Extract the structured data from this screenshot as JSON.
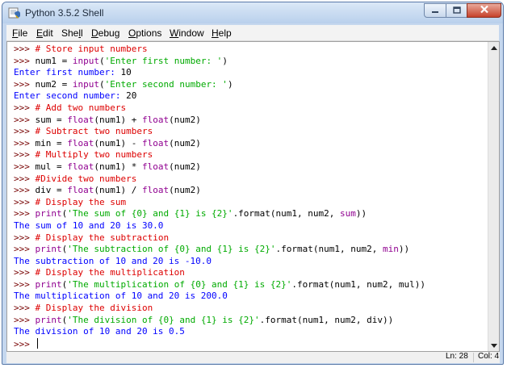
{
  "window": {
    "title": "Python 3.5.2 Shell"
  },
  "menu": [
    {
      "pre": "",
      "u": "F",
      "post": "ile"
    },
    {
      "pre": "",
      "u": "E",
      "post": "dit"
    },
    {
      "pre": "She",
      "u": "l",
      "post": "l"
    },
    {
      "pre": "",
      "u": "D",
      "post": "ebug"
    },
    {
      "pre": "",
      "u": "O",
      "post": "ptions"
    },
    {
      "pre": "",
      "u": "W",
      "post": "indow"
    },
    {
      "pre": "",
      "u": "H",
      "post": "elp"
    }
  ],
  "colors": {
    "prompt": "#770000",
    "comment": "#dd0000",
    "builtin": "#900090",
    "string": "#00aa00",
    "stdout": "#0000ff"
  },
  "shell_lines": [
    [
      {
        "t": "prompt",
        "v": ">>> "
      },
      {
        "t": "comment",
        "v": "# Store input numbers"
      }
    ],
    [
      {
        "t": "prompt",
        "v": ">>> "
      },
      {
        "t": "code",
        "v": "num1 = "
      },
      {
        "t": "builtin",
        "v": "input"
      },
      {
        "t": "code",
        "v": "("
      },
      {
        "t": "string",
        "v": "'Enter first number: '"
      },
      {
        "t": "code",
        "v": ")"
      }
    ],
    [
      {
        "t": "stdout",
        "v": "Enter first number: "
      },
      {
        "t": "code",
        "v": "10"
      }
    ],
    [
      {
        "t": "prompt",
        "v": ">>> "
      },
      {
        "t": "code",
        "v": "num2 = "
      },
      {
        "t": "builtin",
        "v": "input"
      },
      {
        "t": "code",
        "v": "("
      },
      {
        "t": "string",
        "v": "'Enter second number: '"
      },
      {
        "t": "code",
        "v": ")"
      }
    ],
    [
      {
        "t": "stdout",
        "v": "Enter second number: "
      },
      {
        "t": "code",
        "v": "20"
      }
    ],
    [
      {
        "t": "prompt",
        "v": ">>> "
      },
      {
        "t": "comment",
        "v": "# Add two numbers"
      }
    ],
    [
      {
        "t": "prompt",
        "v": ">>> "
      },
      {
        "t": "code",
        "v": "sum = "
      },
      {
        "t": "builtin",
        "v": "float"
      },
      {
        "t": "code",
        "v": "(num1) + "
      },
      {
        "t": "builtin",
        "v": "float"
      },
      {
        "t": "code",
        "v": "(num2)"
      }
    ],
    [
      {
        "t": "prompt",
        "v": ">>> "
      },
      {
        "t": "comment",
        "v": "# Subtract two numbers"
      }
    ],
    [
      {
        "t": "prompt",
        "v": ">>> "
      },
      {
        "t": "code",
        "v": "min = "
      },
      {
        "t": "builtin",
        "v": "float"
      },
      {
        "t": "code",
        "v": "(num1) - "
      },
      {
        "t": "builtin",
        "v": "float"
      },
      {
        "t": "code",
        "v": "(num2)"
      }
    ],
    [
      {
        "t": "prompt",
        "v": ">>> "
      },
      {
        "t": "comment",
        "v": "# Multiply two numbers"
      }
    ],
    [
      {
        "t": "prompt",
        "v": ">>> "
      },
      {
        "t": "code",
        "v": "mul = "
      },
      {
        "t": "builtin",
        "v": "float"
      },
      {
        "t": "code",
        "v": "(num1) * "
      },
      {
        "t": "builtin",
        "v": "float"
      },
      {
        "t": "code",
        "v": "(num2)"
      }
    ],
    [
      {
        "t": "prompt",
        "v": ">>> "
      },
      {
        "t": "comment",
        "v": "#Divide two numbers"
      }
    ],
    [
      {
        "t": "prompt",
        "v": ">>> "
      },
      {
        "t": "code",
        "v": "div = "
      },
      {
        "t": "builtin",
        "v": "float"
      },
      {
        "t": "code",
        "v": "(num1) / "
      },
      {
        "t": "builtin",
        "v": "float"
      },
      {
        "t": "code",
        "v": "(num2)"
      }
    ],
    [
      {
        "t": "prompt",
        "v": ">>> "
      },
      {
        "t": "comment",
        "v": "# Display the sum"
      }
    ],
    [
      {
        "t": "prompt",
        "v": ">>> "
      },
      {
        "t": "builtin",
        "v": "print"
      },
      {
        "t": "code",
        "v": "("
      },
      {
        "t": "string",
        "v": "'The sum of {0} and {1} is {2}'"
      },
      {
        "t": "code",
        "v": ".format(num1, num2, "
      },
      {
        "t": "builtin",
        "v": "sum"
      },
      {
        "t": "code",
        "v": "))"
      }
    ],
    [
      {
        "t": "stdout",
        "v": "The sum of 10 and 20 is 30.0"
      }
    ],
    [
      {
        "t": "prompt",
        "v": ">>> "
      },
      {
        "t": "comment",
        "v": "# Display the subtraction"
      }
    ],
    [
      {
        "t": "prompt",
        "v": ">>> "
      },
      {
        "t": "builtin",
        "v": "print"
      },
      {
        "t": "code",
        "v": "("
      },
      {
        "t": "string",
        "v": "'The subtraction of {0} and {1} is {2}'"
      },
      {
        "t": "code",
        "v": ".format(num1, num2, "
      },
      {
        "t": "builtin",
        "v": "min"
      },
      {
        "t": "code",
        "v": "))"
      }
    ],
    [
      {
        "t": "stdout",
        "v": "The subtraction of 10 and 20 is -10.0"
      }
    ],
    [
      {
        "t": "prompt",
        "v": ">>> "
      },
      {
        "t": "comment",
        "v": "# Display the multiplication"
      }
    ],
    [
      {
        "t": "prompt",
        "v": ">>> "
      },
      {
        "t": "builtin",
        "v": "print"
      },
      {
        "t": "code",
        "v": "("
      },
      {
        "t": "string",
        "v": "'The multiplication of {0} and {1} is {2}'"
      },
      {
        "t": "code",
        "v": ".format(num1, num2, mul))"
      }
    ],
    [
      {
        "t": "stdout",
        "v": "The multiplication of 10 and 20 is 200.0"
      }
    ],
    [
      {
        "t": "prompt",
        "v": ">>> "
      },
      {
        "t": "comment",
        "v": "# Display the division"
      }
    ],
    [
      {
        "t": "prompt",
        "v": ">>> "
      },
      {
        "t": "builtin",
        "v": "print"
      },
      {
        "t": "code",
        "v": "("
      },
      {
        "t": "string",
        "v": "'The division of {0} and {1} is {2}'"
      },
      {
        "t": "code",
        "v": ".format(num1, num2, div))"
      }
    ],
    [
      {
        "t": "stdout",
        "v": "The division of 10 and 20 is 0.5"
      }
    ],
    [
      {
        "t": "prompt",
        "v": ">>> "
      }
    ]
  ],
  "status": {
    "line": "Ln: 28",
    "col": "Col: 4"
  },
  "icons": {
    "app": "python-shell-icon",
    "minimize": "minimize-icon",
    "maximize": "maximize-icon",
    "close": "close-icon",
    "scroll_up": "scroll-up-arrow-icon",
    "scroll_down": "scroll-down-arrow-icon"
  }
}
